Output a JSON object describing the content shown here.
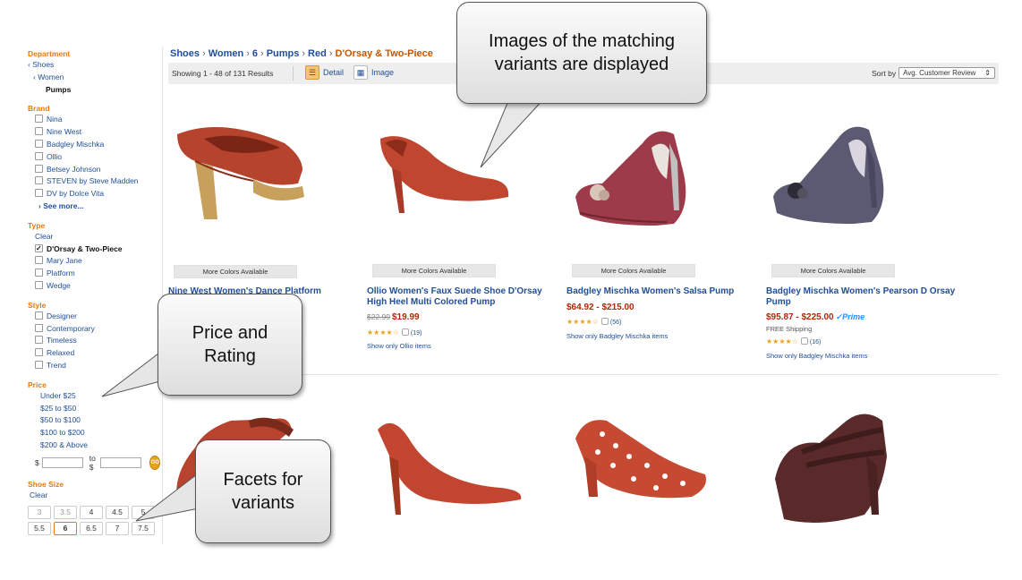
{
  "sidebar": {
    "department": {
      "title": "Department",
      "items": [
        "‹ Shoes",
        "‹ Women",
        "Pumps"
      ]
    },
    "brand": {
      "title": "Brand",
      "items": [
        "Nina",
        "Nine West",
        "Badgley Mischka",
        "Ollio",
        "Betsey Johnson",
        "STEVEN by Steve Madden",
        "DV by Dolce Vita"
      ],
      "see_more": "› See more..."
    },
    "type": {
      "title": "Type",
      "clear": "Clear",
      "items": [
        "D'Orsay & Two-Piece",
        "Mary Jane",
        "Platform",
        "Wedge"
      ],
      "checked": "D'Orsay & Two-Piece"
    },
    "style": {
      "title": "Style",
      "items": [
        "Designer",
        "Contemporary",
        "Timeless",
        "Relaxed",
        "Trend"
      ]
    },
    "price": {
      "title": "Price",
      "items": [
        "Under $25",
        "$25 to $50",
        "$50 to $100",
        "$100 to $200",
        "$200 & Above"
      ],
      "from_label": "$",
      "to_label": "to $",
      "go_label": "GO"
    },
    "shoe_size": {
      "title": "Shoe Size",
      "clear": "Clear",
      "sizes": [
        "3",
        "3.5",
        "4",
        "4.5",
        "5",
        "5.5",
        "6",
        "6.5",
        "7",
        "7.5"
      ],
      "selected": "6"
    }
  },
  "breadcrumb": {
    "items": [
      "Shoes",
      "Women",
      "6",
      "Pumps",
      "Red"
    ],
    "current": "D'Orsay & Two-Piece",
    "separator": "›"
  },
  "toolbar": {
    "results": "Showing 1 - 48 of 131 Results",
    "detail_label": "Detail",
    "image_label": "Image",
    "sort_label": "Sort by",
    "sort_value": "Avg. Customer Review"
  },
  "products": [
    {
      "more_colors": "More Colors Available",
      "title": "Nine West Women's Dance Platform"
    },
    {
      "more_colors": "More Colors Available",
      "title": "Ollio Women's Faux Suede Shoe D'Orsay High Heel Multi Colored Pump",
      "old_price": "$22.99",
      "price": "$19.99",
      "reviews": "(19)",
      "show_only": "Show only Ollio items"
    },
    {
      "more_colors": "More Colors Available",
      "title": "Badgley Mischka Women's Salsa Pump",
      "price": "$64.92 - $215.00",
      "reviews": "(56)",
      "show_only": "Show only Badgley Mischka items"
    },
    {
      "more_colors": "More Colors Available",
      "title": "Badgley Mischka Women's Pearson D Orsay Pump",
      "price": "$95.87 - $225.00",
      "prime": "✓Prime",
      "shipping": "FREE Shipping",
      "reviews": "(16)",
      "show_only": "Show only Badgley Mischka items"
    }
  ],
  "callouts": {
    "images": "Images of the matching\nvariants are displayed",
    "price_rating": "Price and\nRating",
    "facets": "Facets for\nvariants"
  },
  "colors": {
    "link": "#1f4e98",
    "facet_title": "#e47911",
    "price": "#b12704",
    "star": "#e8a31d"
  }
}
